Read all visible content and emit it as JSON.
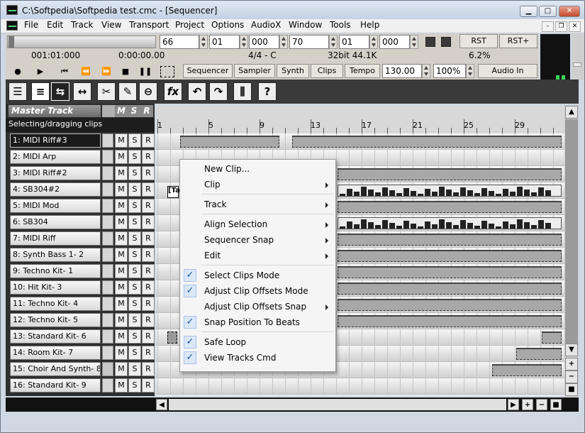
{
  "window": {
    "title": "C:\\Softpedia\\Softpedia test.cmc - [Sequencer]",
    "minimize": "▁",
    "maximize": "□",
    "close": "✕"
  },
  "menu": [
    "File",
    "Edit",
    "Track",
    "View",
    "Transport",
    "Project",
    "Options",
    "AudioX",
    "Window",
    "Tools",
    "Help"
  ],
  "mdi": {
    "min": "–",
    "restore": "❐",
    "close": "✕"
  },
  "transport": {
    "spins": [
      "66",
      "01",
      "000",
      "70",
      "01",
      "000"
    ],
    "rst": "RST",
    "rstplus": "RST+",
    "time_bar": "001:01:000",
    "time_clock": "0:00:00.00",
    "signature": "4/4 - C",
    "format": "32bit 44.1K",
    "cpu": "6.2%",
    "tabs": [
      "Sequencer",
      "Sampler",
      "Synth",
      "Clips",
      "Tempo"
    ],
    "tempo": "130.00",
    "zoom": "100%",
    "audio_in": "Audio In"
  },
  "toolbar_icons": [
    "track-list-icon",
    "lanes-icon",
    "select-offset-icon",
    "fit-range-icon",
    "scissors-icon",
    "paint-icon",
    "mute-tool-icon",
    "fx-icon",
    "undo-icon",
    "redo-icon",
    "mixer-icon",
    "help-icon"
  ],
  "master": {
    "label": "Master Track",
    "m": "M",
    "s": "S",
    "r": "R",
    "status": "Selecting/dragging clips"
  },
  "tracks": [
    {
      "name": "1: MIDI Riff#3"
    },
    {
      "name": "2: MIDI Arp"
    },
    {
      "name": "3: MIDI Riff#2"
    },
    {
      "name": "4: SB304#2"
    },
    {
      "name": "5: MIDI Mod"
    },
    {
      "name": "6: SB304"
    },
    {
      "name": "7: MIDI Riff"
    },
    {
      "name": "8: Synth Bass 1- 2"
    },
    {
      "name": "9: Techno Kit- 1"
    },
    {
      "name": "10: Hit Kit- 3"
    },
    {
      "name": "11: Techno Kit- 4"
    },
    {
      "name": "12: Techno Kit- 5"
    },
    {
      "name": "13: Standard Kit- 6"
    },
    {
      "name": "14: Room Kit- 7"
    },
    {
      "name": "15: Choir And Synth- 8"
    },
    {
      "name": "16: Standard Kit- 9"
    }
  ],
  "msr": {
    "m": "M",
    "s": "S",
    "r": "R"
  },
  "ruler": [
    "1",
    "5",
    "9",
    "13",
    "17",
    "21",
    "25",
    "29"
  ],
  "context_menu": [
    {
      "label": "New Clip...",
      "arrow": false,
      "check": false
    },
    {
      "label": "Clip",
      "arrow": true,
      "check": false
    },
    {
      "sep": true
    },
    {
      "label": "Track",
      "arrow": true,
      "check": false
    },
    {
      "sep": true
    },
    {
      "label": "Align Selection",
      "arrow": true,
      "check": false
    },
    {
      "label": "Sequencer Snap",
      "arrow": true,
      "check": false
    },
    {
      "label": "Edit",
      "arrow": true,
      "check": false
    },
    {
      "sep": true
    },
    {
      "label": "Select Clips Mode",
      "arrow": false,
      "check": true
    },
    {
      "label": "Adjust Clip Offsets Mode",
      "arrow": false,
      "check": true
    },
    {
      "label": "Adjust Clip Offsets Snap",
      "arrow": true,
      "check": false
    },
    {
      "label": "Snap Position To Beats",
      "arrow": false,
      "check": true
    },
    {
      "sep": true
    },
    {
      "label": "Safe Loop",
      "arrow": false,
      "check": true
    },
    {
      "label": "View Tracks Cmd",
      "arrow": false,
      "check": true
    }
  ],
  "checkmark": "✓",
  "clip4_label": "[Ta"
}
